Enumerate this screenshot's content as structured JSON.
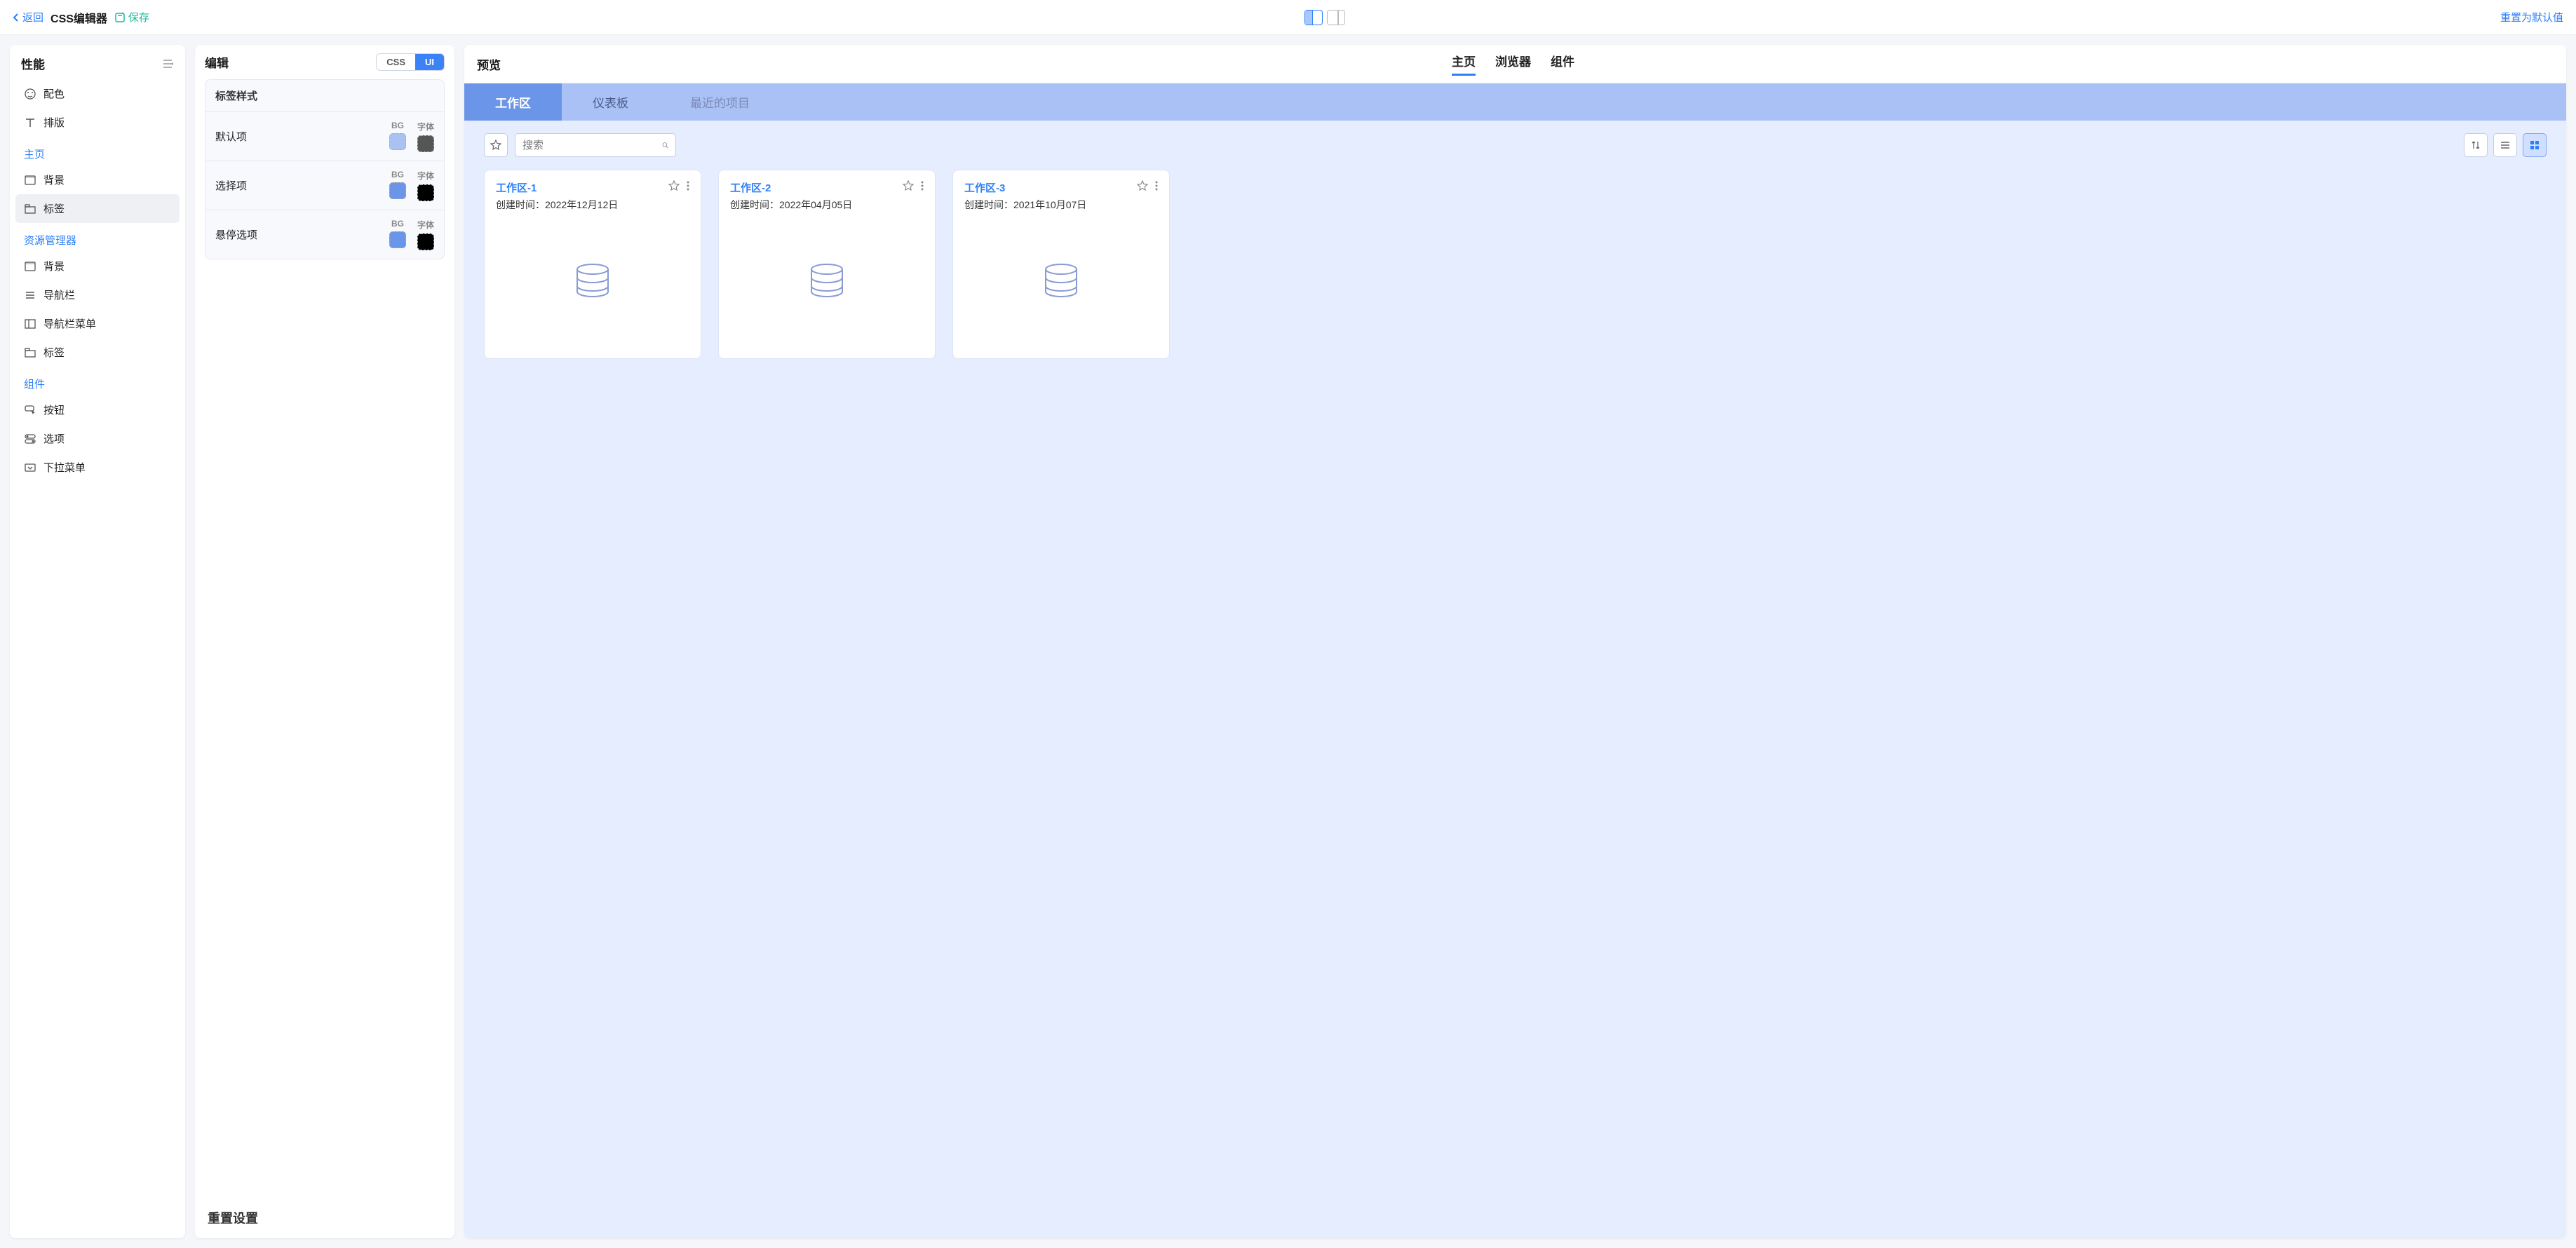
{
  "topbar": {
    "back": "返回",
    "title": "CSS编辑器",
    "save": "保存",
    "reset": "重置为默认值"
  },
  "sidebar": {
    "title": "性能",
    "items": [
      {
        "group": null,
        "label": "配色"
      },
      {
        "group": null,
        "label": "排版"
      }
    ],
    "groups": [
      {
        "name": "主页",
        "items": [
          "背景",
          "标签"
        ]
      },
      {
        "name": "资源管理器",
        "items": [
          "背景",
          "导航栏",
          "导航栏菜单",
          "标签"
        ]
      },
      {
        "name": "组件",
        "items": [
          "按钮",
          "选项",
          "下拉菜单"
        ]
      }
    ]
  },
  "editor": {
    "title": "编辑",
    "toggle": {
      "css": "CSS",
      "ui": "UI"
    },
    "section_title": "标签样式",
    "bg_label": "BG",
    "font_label": "字体",
    "rows": [
      {
        "name": "默认项",
        "bg": "#a9c1f5",
        "font": "#555555"
      },
      {
        "name": "选择项",
        "bg": "#6b95e8",
        "font": "#000000"
      },
      {
        "name": "悬停选项",
        "bg": "#6b95e8",
        "font": "#000000"
      }
    ],
    "reset_title": "重置设置"
  },
  "preview": {
    "title": "预览",
    "tabs": [
      "主页",
      "浏览器",
      "组件"
    ],
    "inner_tabs": [
      "工作区",
      "仪表板",
      "最近的项目"
    ],
    "search_placeholder": "搜索",
    "created_prefix": "创建时间：",
    "cards": [
      {
        "title": "工作区-1",
        "created": "2022年12月12日"
      },
      {
        "title": "工作区-2",
        "created": "2022年04月05日"
      },
      {
        "title": "工作区-3",
        "created": "2021年10月07日"
      }
    ]
  }
}
